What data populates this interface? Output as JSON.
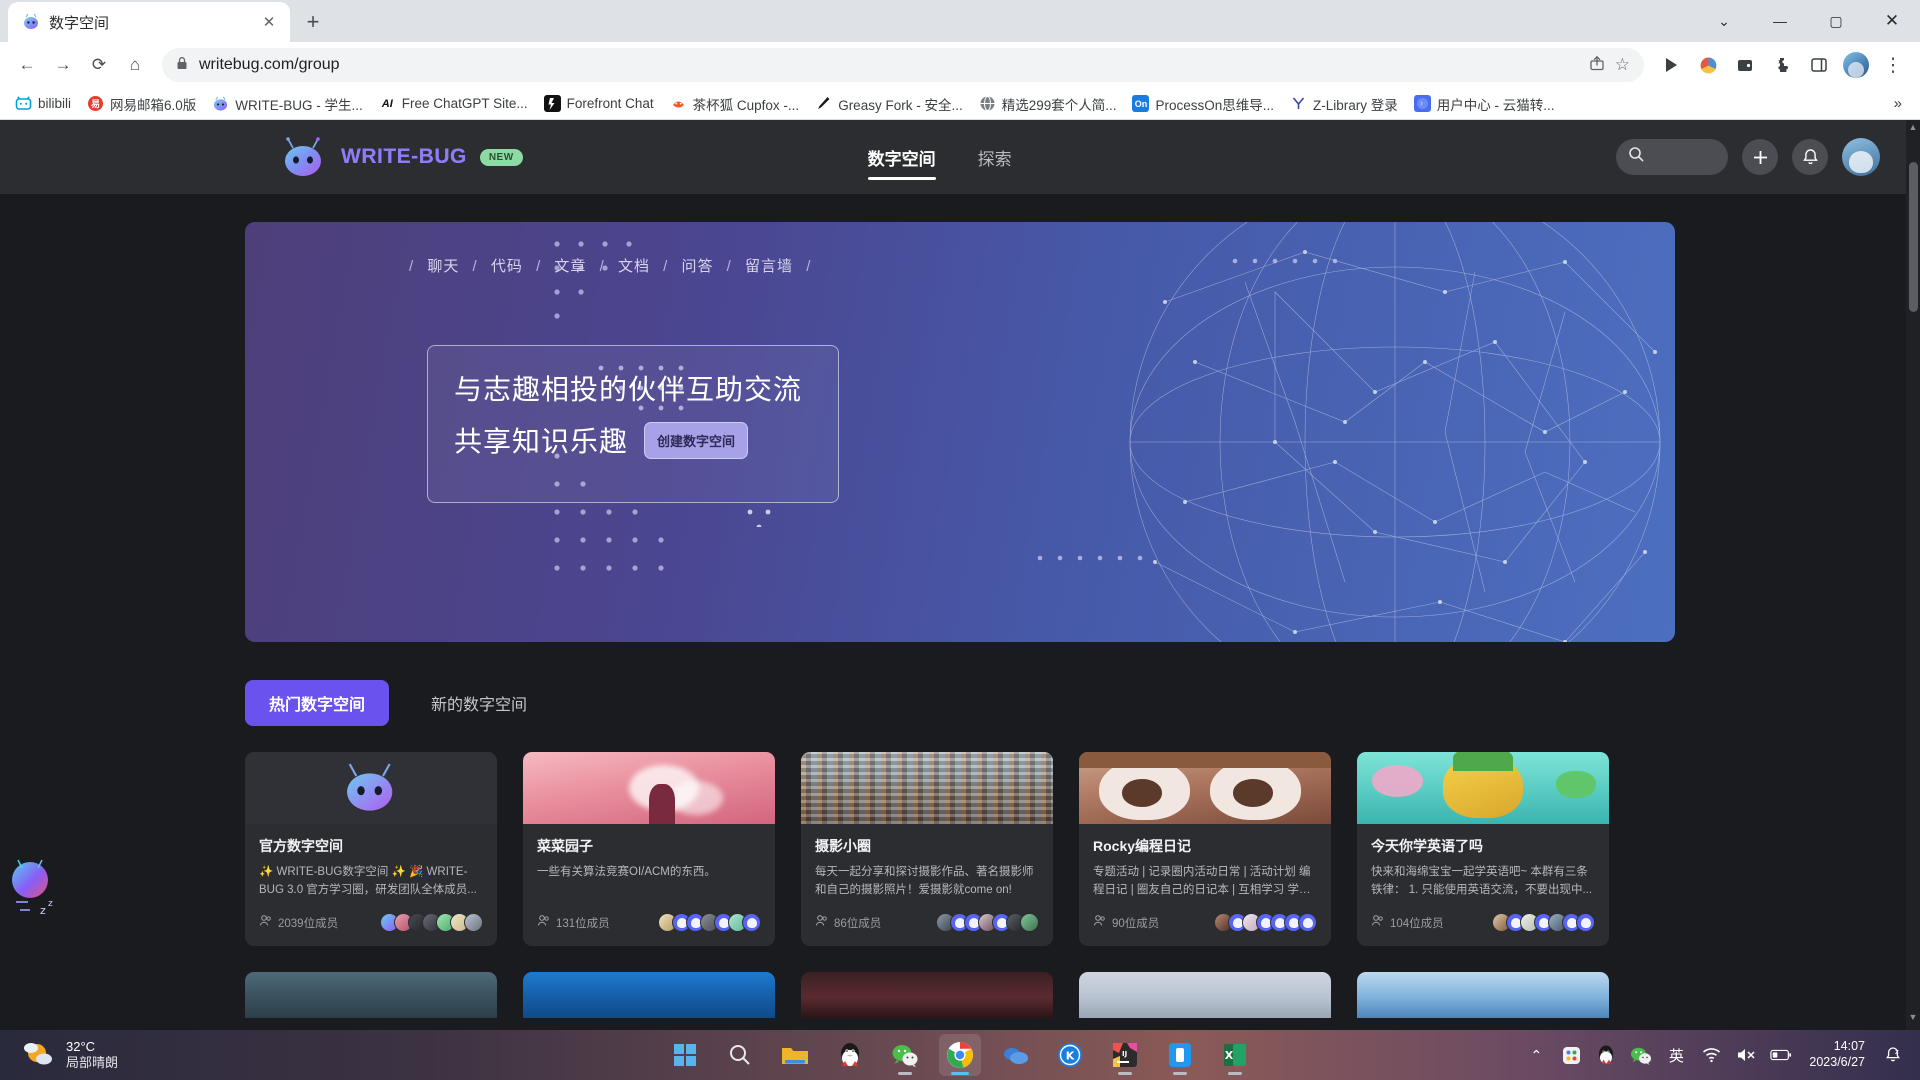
{
  "browser": {
    "tab": {
      "title": "数字空间",
      "favicon": "writebug-bug-icon",
      "close_label": "✕"
    },
    "new_tab_label": "+",
    "window_controls": {
      "minimize": "—",
      "maximize": "▢",
      "close": "✕",
      "chevron": "⌄"
    },
    "nav": {
      "back": "←",
      "forward": "→",
      "reload": "⟳",
      "home": "⌂"
    },
    "omnibox": {
      "lock_icon": "lock-icon",
      "url": "writebug.com/group",
      "share_icon": "⇪",
      "star_icon": "☆"
    },
    "toolbar_right": [
      "media-play-icon",
      "colorful-extension-icon",
      "wallet-icon",
      "puzzle-extension-icon",
      "sidepanel-icon",
      "profile-avatar",
      "menu-kebab-icon"
    ],
    "bookmarks": [
      {
        "label": "bilibili",
        "icon": "bilibili-icon"
      },
      {
        "label": "网易邮箱6.0版",
        "icon": "netease-mail-icon"
      },
      {
        "label": "WRITE-BUG - 学生...",
        "icon": "writebug-icon"
      },
      {
        "label": "Free ChatGPT Site...",
        "icon": "ai-icon"
      },
      {
        "label": "Forefront Chat",
        "icon": "forefront-icon"
      },
      {
        "label": "茶杯狐 Cupfox -...",
        "icon": "cupfox-icon"
      },
      {
        "label": "Greasy Fork - 安全...",
        "icon": "greasyfork-icon"
      },
      {
        "label": "精选299套个人简...",
        "icon": "globe-icon"
      },
      {
        "label": "ProcessOn思维导...",
        "icon": "processon-icon"
      },
      {
        "label": "Z-Library 登录",
        "icon": "zlibrary-icon"
      },
      {
        "label": "用户中心 - 云猫转...",
        "icon": "yunmao-icon"
      }
    ],
    "bookmarks_overflow": "»"
  },
  "site": {
    "brand": {
      "name": "WRITE-BUG",
      "badge": "NEW",
      "logo": "writebug-robot-logo"
    },
    "nav": [
      {
        "label": "数字空间",
        "active": true
      },
      {
        "label": "探索",
        "active": false
      }
    ],
    "header_actions": {
      "search_icon": "search-icon",
      "add_icon": "plus-icon",
      "notification_icon": "bell-icon",
      "avatar": "user-avatar"
    }
  },
  "hero": {
    "crumbs": [
      "聊天",
      "代码",
      "文章",
      "文档",
      "问答",
      "留言墙"
    ],
    "separator": "/",
    "headline_line1": "与志趣相投的伙伴互助交流",
    "headline_line2": "共享知识乐趣",
    "cta": "创建数字空间"
  },
  "filters": [
    {
      "label": "热门数字空间",
      "active": true
    },
    {
      "label": "新的数字空间",
      "active": false
    }
  ],
  "cards": [
    {
      "title": "官方数字空间",
      "desc": "✨ WRITE-BUG数字空间 ✨ 🎉 WRITE-BUG 3.0 官方学习圈，研发团队全体成员...",
      "members": "2039位成员",
      "cover": "writebug-logo-cover",
      "avatars": [
        "writebug-bot",
        "photo-1",
        "photo-2",
        "photo-3",
        "green-photo",
        "cream-photo",
        "photo-4"
      ]
    },
    {
      "title": "菜菜园子",
      "desc": "一些有关算法竞赛OI/ACM的东西。",
      "members": "131位成员",
      "cover": "pink-clouds-cover",
      "avatars": [
        "photo-1",
        "bot",
        "bot",
        "photo-2",
        "bot",
        "photo-3",
        "bot"
      ]
    },
    {
      "title": "摄影小圈",
      "desc": "每天一起分享和探讨摄影作品、著名摄影师和自己的摄影照片！爱摄影就come on!",
      "members": "86位成员",
      "cover": "cityscape-cover",
      "avatars": [
        "photo-1",
        "bot",
        "bot",
        "photo-2",
        "bot",
        "photo-3",
        "photo-4"
      ]
    },
    {
      "title": "Rocky编程日记",
      "desc": "专题活动 | 记录圈内活动日常 | 活动计划 编程日记 | 圈友自己的日记本 | 互相学习 学习...",
      "members": "90位成员",
      "cover": "anime-cover",
      "avatars": [
        "photo-1",
        "bot",
        "photo-2",
        "bot",
        "bot",
        "bot",
        "bot"
      ]
    },
    {
      "title": "今天你学英语了吗",
      "desc": "快来和海绵宝宝一起学英语吧~ 本群有三条铁律： 1. 只能使用英语交流，不要出现中...",
      "members": "104位成员",
      "cover": "spongebob-cover",
      "avatars": [
        "photo-1",
        "bot",
        "photo-2",
        "bot",
        "photo-3",
        "bot",
        "bot"
      ]
    }
  ],
  "cards_row2": [
    {
      "cover": "forest-snow-cover"
    },
    {
      "cover": "blue-tech-cover"
    },
    {
      "cover": "dark-anime-cover"
    },
    {
      "cover": "light-cover"
    },
    {
      "cover": "blue-sky-cover"
    }
  ],
  "taskbar": {
    "weather": {
      "temp": "32°C",
      "desc": "局部晴朗",
      "icon": "sun-cloud-icon"
    },
    "apps": [
      {
        "name": "start-button",
        "icon": "windows-icon"
      },
      {
        "name": "search",
        "icon": "search-icon"
      },
      {
        "name": "file-explorer",
        "icon": "folder-icon"
      },
      {
        "name": "qq",
        "icon": "penguin-icon"
      },
      {
        "name": "wechat",
        "icon": "wechat-icon"
      },
      {
        "name": "chrome",
        "icon": "chrome-icon"
      },
      {
        "name": "onedrive",
        "icon": "cloud-icon"
      },
      {
        "name": "kingsoft",
        "icon": "k-icon"
      },
      {
        "name": "intellij-idea",
        "icon": "ij-icon"
      },
      {
        "name": "phone-link",
        "icon": "phone-icon"
      },
      {
        "name": "excel",
        "icon": "excel-icon"
      }
    ],
    "tray": {
      "chevron": "⌃",
      "icons": [
        "colorful-app-icon",
        "qq-icon",
        "wechat-icon"
      ],
      "ime": "英",
      "wifi": "wifi-icon",
      "volume": "volume-muted-icon",
      "battery": "battery-icon",
      "notification": "sleep-bell-icon"
    },
    "clock": {
      "time": "14:07",
      "date": "2023/6/27"
    }
  }
}
